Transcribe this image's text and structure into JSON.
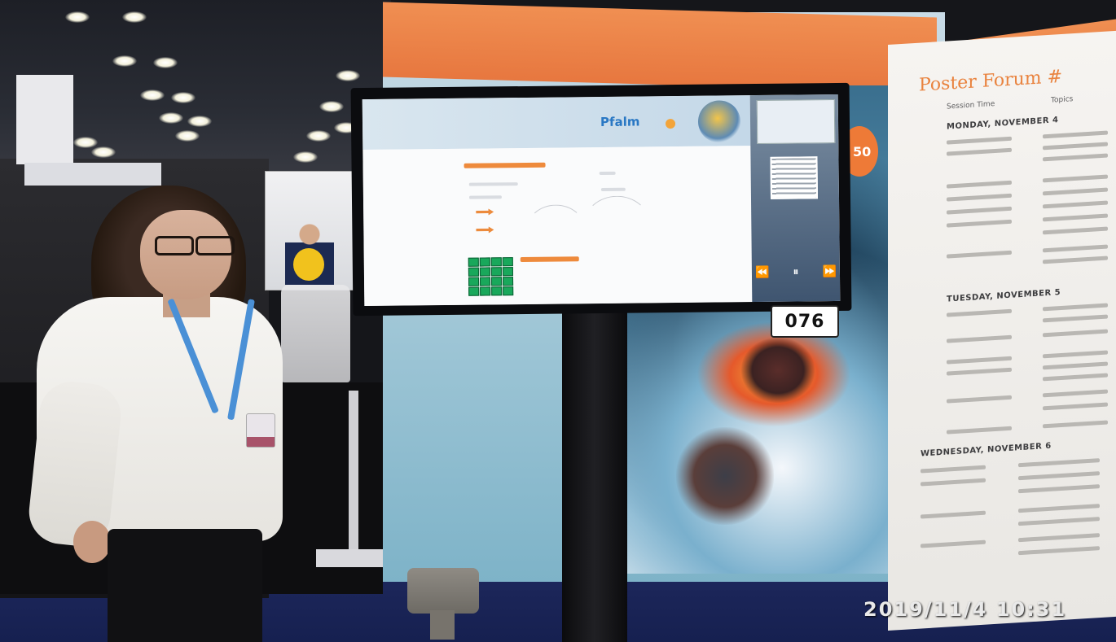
{
  "photo": {
    "timestamp": "2019/11/4  10:31",
    "booth_number": "076",
    "backdrop_badge": "50"
  },
  "screen": {
    "logo": "Pfalm"
  },
  "poster_forum": {
    "title": "Poster Forum #",
    "col_session_time": "Session Time",
    "col_topics": "Topics",
    "day_1": "MONDAY, NOVEMBER 4",
    "day_2": "TUESDAY, NOVEMBER 5",
    "day_3": "WEDNESDAY, NOVEMBER 6"
  },
  "colors": {
    "accent_orange": "#ee7a37",
    "carpet_blue": "#1b2558",
    "screen_green": "#19a85b"
  },
  "icons": [
    "ceiling-light-icon",
    "rewind-icon",
    "pause-icon",
    "fast-forward-icon"
  ]
}
